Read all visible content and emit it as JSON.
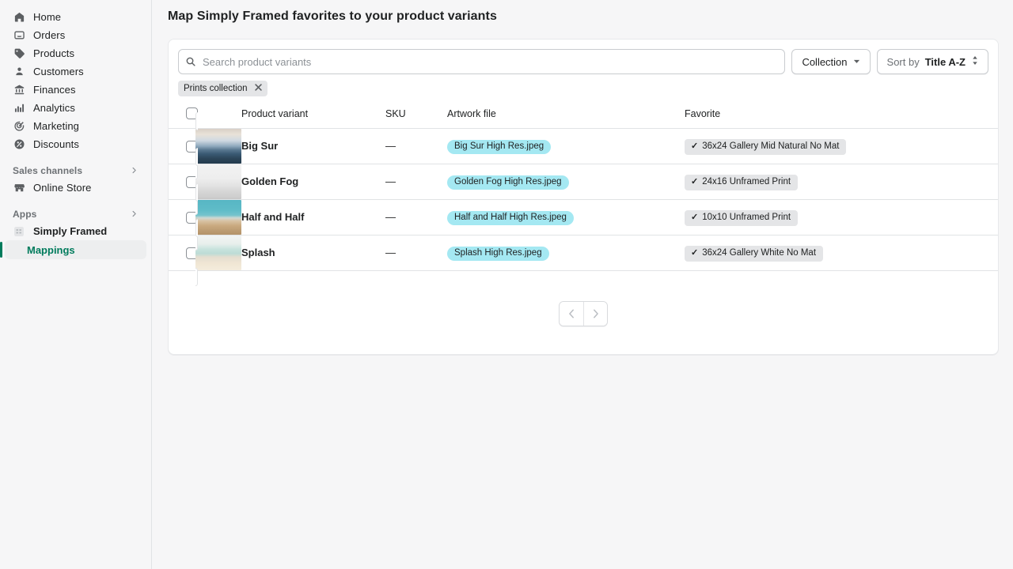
{
  "sidebar": {
    "nav": [
      {
        "label": "Home",
        "icon": "home-icon"
      },
      {
        "label": "Orders",
        "icon": "orders-inbox-icon"
      },
      {
        "label": "Products",
        "icon": "products-tag-icon"
      },
      {
        "label": "Customers",
        "icon": "customers-person-icon"
      },
      {
        "label": "Finances",
        "icon": "finances-bank-icon"
      },
      {
        "label": "Analytics",
        "icon": "analytics-bars-icon"
      },
      {
        "label": "Marketing",
        "icon": "marketing-target-icon"
      },
      {
        "label": "Discounts",
        "icon": "discounts-percent-icon"
      }
    ],
    "sales_channels": {
      "label": "Sales channels",
      "chevron": "chevron-right-icon"
    },
    "online_store": {
      "label": "Online Store",
      "icon": "storefront-icon"
    },
    "apps": {
      "label": "Apps",
      "chevron": "chevron-right-icon"
    },
    "app_item": {
      "label": "Simply Framed",
      "icon": "app-placeholder-icon"
    },
    "sub_item": {
      "label": "Mappings"
    },
    "accent_color": "#007b5c"
  },
  "page": {
    "title": "Map Simply Framed favorites to your product variants"
  },
  "search": {
    "placeholder": "Search product variants",
    "value": "",
    "icon": "search-icon"
  },
  "toolbar": {
    "collection_label": "Collection",
    "collection_caret": "chevron-down-icon",
    "sort_label": "Sort by",
    "sort_value": "Title A-Z",
    "sort_icon": "sort-updown-icon"
  },
  "chips": [
    {
      "label": "Prints collection",
      "remove_icon": "close-icon"
    }
  ],
  "table": {
    "columns": [
      "",
      "",
      "Product variant",
      "SKU",
      "Artwork file",
      "Favorite"
    ],
    "headers": {
      "product_variant": "Product variant",
      "sku": "SKU",
      "artwork_file": "Artwork file",
      "favorite": "Favorite"
    },
    "rows": [
      {
        "variant": "Big Sur",
        "sku": "—",
        "artwork": "Big Sur High Res.jpeg",
        "favorite": "36x24 Gallery Mid Natural No Mat",
        "favorite_check": "✓",
        "thumb_gradient": "linear-gradient(180deg,#d8cfc6 0%,#e9e2d8 16%,#cfd9e2 34%,#8fa9bd 50%,#5b7a92 60%,#3a5a74 72%,#2b4458 86%,#233b4d 100%)"
      },
      {
        "variant": "Golden Fog",
        "sku": "—",
        "artwork": "Golden Fog High Res.jpeg",
        "favorite": "24x16 Unframed Print",
        "favorite_check": "✓",
        "thumb_gradient": "linear-gradient(180deg,#f2f2f2 0%,#eeeeee 40%,#e2e2e2 62%,#d6d6d6 78%,#cfcfcf 92%,#c7c7c7 100%)"
      },
      {
        "variant": "Half and Half",
        "sku": "—",
        "artwork": "Half and Half High Res.jpeg",
        "favorite": "10x10 Unframed Print",
        "favorite_check": "✓",
        "thumb_gradient": "linear-gradient(180deg,#57b6c4 0%,#5fbcc8 30%,#74c3cc 44%,#cfd8d2 52%,#d8c3a4 60%,#c9a97f 74%,#bc9c72 88%,#b39268 100%)"
      },
      {
        "variant": "Splash",
        "sku": "—",
        "artwork": "Splash High Res.jpeg",
        "favorite": "36x24 Gallery White No Mat",
        "favorite_check": "✓",
        "thumb_gradient": "linear-gradient(180deg,#f2f4f3 0%,#e8efec 24%,#c7e2dc 40%,#bcdcd6 52%,#e4ded0 62%,#f0e6d4 80%,#f4ecdc 100%)"
      }
    ]
  },
  "pagination": {
    "prev_icon": "chevron-left-icon",
    "next_icon": "chevron-right-icon",
    "prev_label": "‹",
    "next_label": "›"
  },
  "colors": {
    "accent": "#007b5c",
    "artwork_badge": "#a4e8f2",
    "favorite_badge": "#e4e5e7",
    "page_bg": "#f6f6f7"
  }
}
